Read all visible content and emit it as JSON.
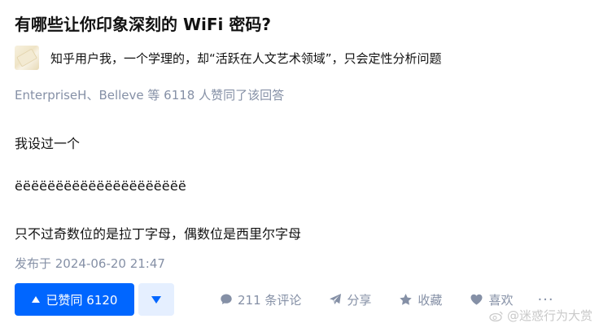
{
  "question": {
    "title": "有哪些让你印象深刻的 WiFi 密码?"
  },
  "author": {
    "bio_line": "知乎用户我，一个学理的，却“活跃在人文艺术领域”，只会定性分析问题"
  },
  "likers": {
    "text": "EnterpriseH、Belleve 等 6118 人赞同了该回答"
  },
  "content": {
    "p1": "我设过一个",
    "p2": "ëëëëëëëëëëëëëëëëëëëëë",
    "p3": "只不过奇数位的是拉丁字母，偶数位是西里尔字母"
  },
  "published": {
    "text": "发布于 2024-06-20 21:47"
  },
  "actions": {
    "vote_label": "已赞同 6120",
    "comment_label": "211 条评论",
    "share_label": "分享",
    "favorite_label": "收藏",
    "like_label": "喜欢",
    "more_label": "···"
  },
  "watermark": {
    "text": "@迷惑行为大赏"
  },
  "colors": {
    "primary_blue": "#0066ff",
    "downvote_bg": "#e5efff",
    "meta_gray": "#8590a6"
  },
  "icons": {
    "comment": "comment-bubble-icon",
    "share": "paper-plane-icon",
    "favorite": "star-icon",
    "like": "heart-icon",
    "more": "more-dots-icon"
  }
}
